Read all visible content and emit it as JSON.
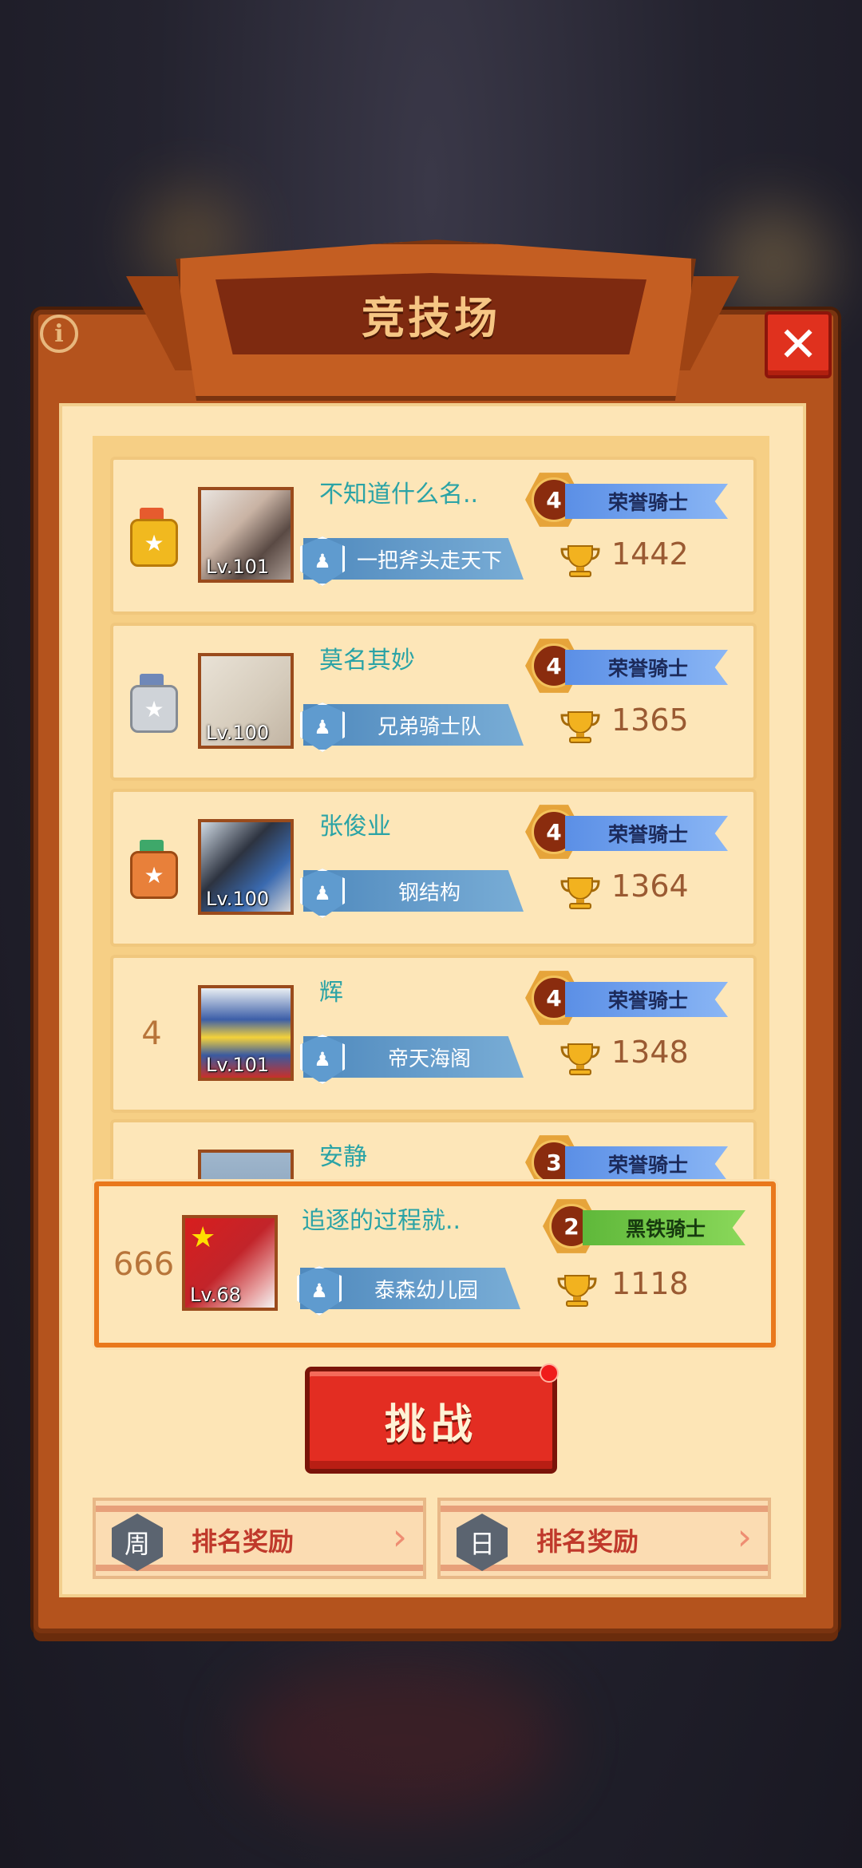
{
  "header": {
    "title": "竞技场",
    "info_icon": "info-icon",
    "close_icon": "close-icon"
  },
  "rows": [
    {
      "rank": "1",
      "rank_icon": "gold-medal-icon",
      "name": "不知道什么名..",
      "level": "Lv.101",
      "guild": "一把斧头走天下",
      "tier": "4",
      "title": "荣誉骑士",
      "score": "1442"
    },
    {
      "rank": "2",
      "rank_icon": "silver-medal-icon",
      "name": "莫名其妙",
      "level": "Lv.100",
      "guild": "兄弟骑士队",
      "tier": "4",
      "title": "荣誉骑士",
      "score": "1365"
    },
    {
      "rank": "3",
      "rank_icon": "bronze-medal-icon",
      "name": "张俊业",
      "level": "Lv.100",
      "guild": "钢结构",
      "tier": "4",
      "title": "荣誉骑士",
      "score": "1364"
    },
    {
      "rank": "4",
      "name": "辉",
      "level": "Lv.101",
      "guild": "帝天海阁",
      "tier": "4",
      "title": "荣誉骑士",
      "score": "1348"
    },
    {
      "rank": "",
      "name": "安静",
      "tier": "3",
      "title": "荣誉骑士"
    }
  ],
  "self": {
    "rank": "666",
    "name": "追逐的过程就..",
    "level": "Lv.68",
    "guild": "泰森幼儿园",
    "tier": "2",
    "title": "黑铁骑士",
    "score": "1118"
  },
  "challenge_label": "挑战",
  "rewards": [
    {
      "badge": "周",
      "label": "排名奖励"
    },
    {
      "badge": "日",
      "label": "排名奖励"
    }
  ],
  "colors": {
    "accent_red": "#e32d22",
    "frame_brown": "#b4531d",
    "name_teal": "#2aa3a6"
  }
}
